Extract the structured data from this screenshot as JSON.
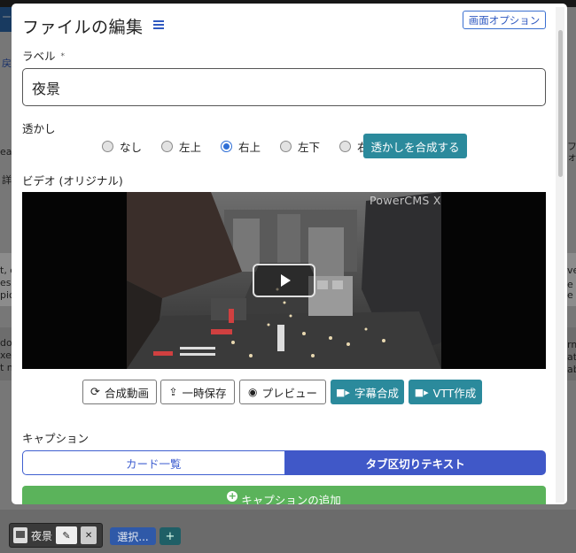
{
  "background": {
    "fragments": [
      "ージ",
      "戻",
      "eas",
      "t, c",
      "es n",
      "pic",
      "do",
      "xe",
      "t n",
      "フォ",
      "ve",
      "e e",
      "rm",
      "ate",
      "ab",
      "詳"
    ],
    "thumbnail_name": "夜景",
    "edit_icon": "pencil-icon",
    "remove_icon": "close-icon",
    "select_label": "選択...",
    "add_icon": "plus-icon"
  },
  "modal": {
    "title": "ファイルの編集",
    "screen_options_label": "画面オプション",
    "label_field": {
      "label": "ラベル",
      "required_mark": "*",
      "value": "夜景"
    },
    "watermark": {
      "label": "透かし",
      "options": [
        "なし",
        "左上",
        "右上",
        "左下",
        "右下"
      ],
      "selected": "右上",
      "apply_label": "透かしを合成する"
    },
    "video": {
      "label": "ビデオ (オリジナル)",
      "overlay_text": "PowerCMS X"
    },
    "video_actions": {
      "composite": "合成動画",
      "temp_save": "一時保存",
      "preview": "プレビュー",
      "subtitle_composite": "字幕合成",
      "vtt": "VTT作成"
    },
    "caption": {
      "label": "キャプション",
      "tabs": [
        "カード一覧",
        "タブ区切りテキスト"
      ],
      "active_tab": "タブ区切りテキスト",
      "add_label": "キャプションの追加"
    }
  },
  "colors": {
    "teal_button": "#2b8a9c",
    "active_tab": "#4058c8",
    "add_button": "#5bb35b",
    "link_blue": "#2f59c0"
  }
}
